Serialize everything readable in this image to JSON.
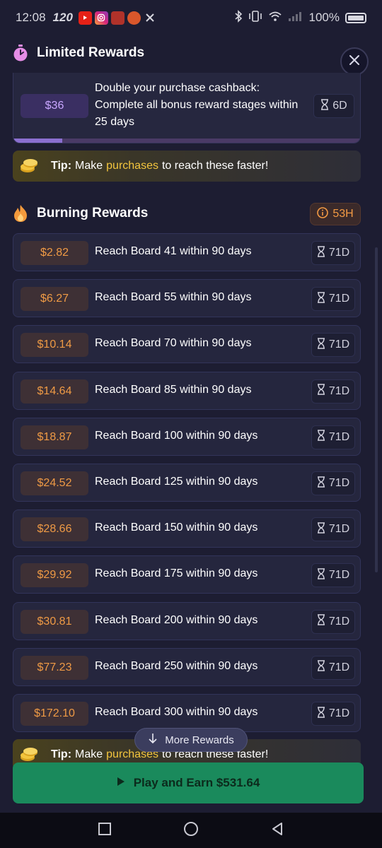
{
  "status_bar": {
    "time": "12:08",
    "refresh": "120",
    "battery": "100%"
  },
  "close_icon": "close-icon",
  "limited": {
    "title": "Limited Rewards",
    "amount": "$36",
    "description": "Double your purchase cashback: Complete all bonus reward stages within 25 days",
    "timer": "6D",
    "progress_fraction": 0.14
  },
  "tip": {
    "label": "Tip:",
    "before": "Make",
    "highlight": "purchases",
    "after": "to reach these faster!"
  },
  "burning": {
    "title": "Burning Rewards",
    "hours": "53H",
    "rewards": [
      {
        "amount": "$2.82",
        "label": "Reach Board 41 within 90 days",
        "timer": "71D"
      },
      {
        "amount": "$6.27",
        "label": "Reach Board 55 within 90 days",
        "timer": "71D"
      },
      {
        "amount": "$10.14",
        "label": "Reach Board 70 within 90 days",
        "timer": "71D"
      },
      {
        "amount": "$14.64",
        "label": "Reach Board 85 within 90 days",
        "timer": "71D"
      },
      {
        "amount": "$18.87",
        "label": "Reach Board 100 within 90 days",
        "timer": "71D"
      },
      {
        "amount": "$24.52",
        "label": "Reach Board 125 within 90 days",
        "timer": "71D"
      },
      {
        "amount": "$28.66",
        "label": "Reach Board 150 within 90 days",
        "timer": "71D"
      },
      {
        "amount": "$29.92",
        "label": "Reach Board 175 within 90 days",
        "timer": "71D"
      },
      {
        "amount": "$30.81",
        "label": "Reach Board 200 within 90 days",
        "timer": "71D"
      },
      {
        "amount": "$77.23",
        "label": "Reach Board 250 within 90 days",
        "timer": "71D"
      },
      {
        "amount": "$172.10",
        "label": "Reach Board 300 within 90 days",
        "timer": "71D"
      }
    ]
  },
  "more_rewards": "More Rewards",
  "play_button": "Play and Earn $531.64",
  "colors": {
    "background": "#1d1d32",
    "amount_text": "#ef9a45",
    "highlight": "#f3c53e",
    "play_button": "#1a8a5c"
  }
}
